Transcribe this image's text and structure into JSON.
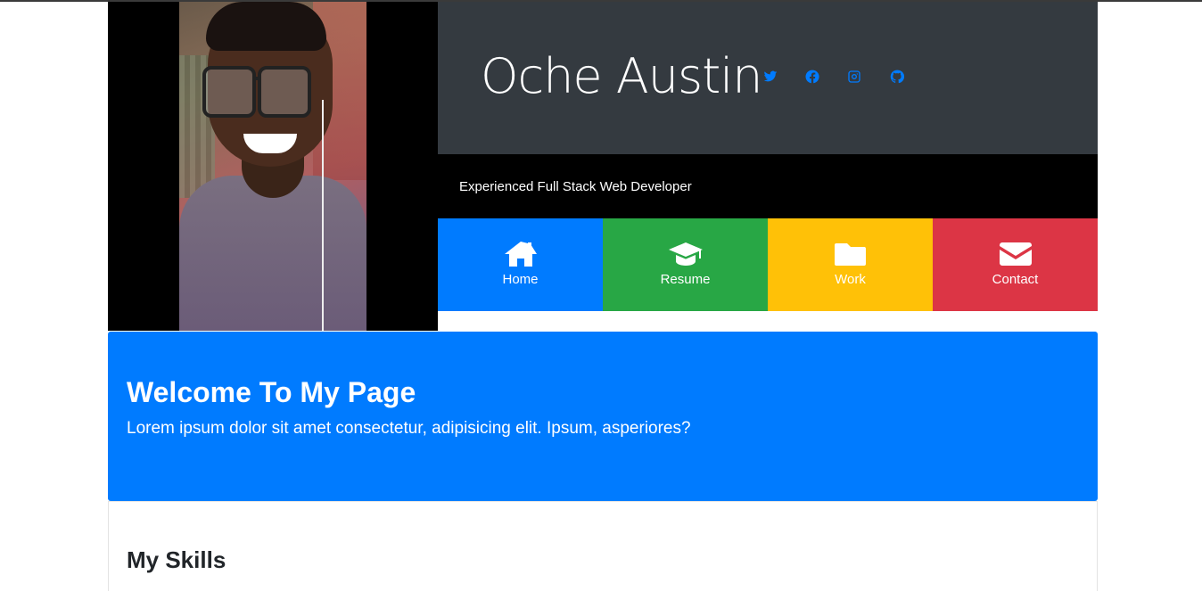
{
  "header": {
    "name": "Oche Austin",
    "tagline": "Experienced Full Stack Web Developer",
    "social": [
      {
        "icon": "twitter-icon"
      },
      {
        "icon": "facebook-icon"
      },
      {
        "icon": "instagram-icon"
      },
      {
        "icon": "github-icon"
      }
    ]
  },
  "nav": {
    "items": [
      {
        "label": "Home",
        "icon": "home-icon",
        "color": "#007bff"
      },
      {
        "label": "Resume",
        "icon": "graduation-cap-icon",
        "color": "#28a745"
      },
      {
        "label": "Work",
        "icon": "folder-icon",
        "color": "#ffc107"
      },
      {
        "label": "Contact",
        "icon": "envelope-icon",
        "color": "#dc3545"
      }
    ]
  },
  "welcome": {
    "title": "Welcome To My Page",
    "text": "Lorem ipsum dolor sit amet consectetur, adipisicing elit. Ipsum, asperiores?"
  },
  "skills": {
    "title": "My Skills"
  },
  "colors": {
    "primary": "#007bff",
    "dark": "#343a40",
    "success": "#28a745",
    "warning": "#ffc107",
    "danger": "#dc3545"
  }
}
